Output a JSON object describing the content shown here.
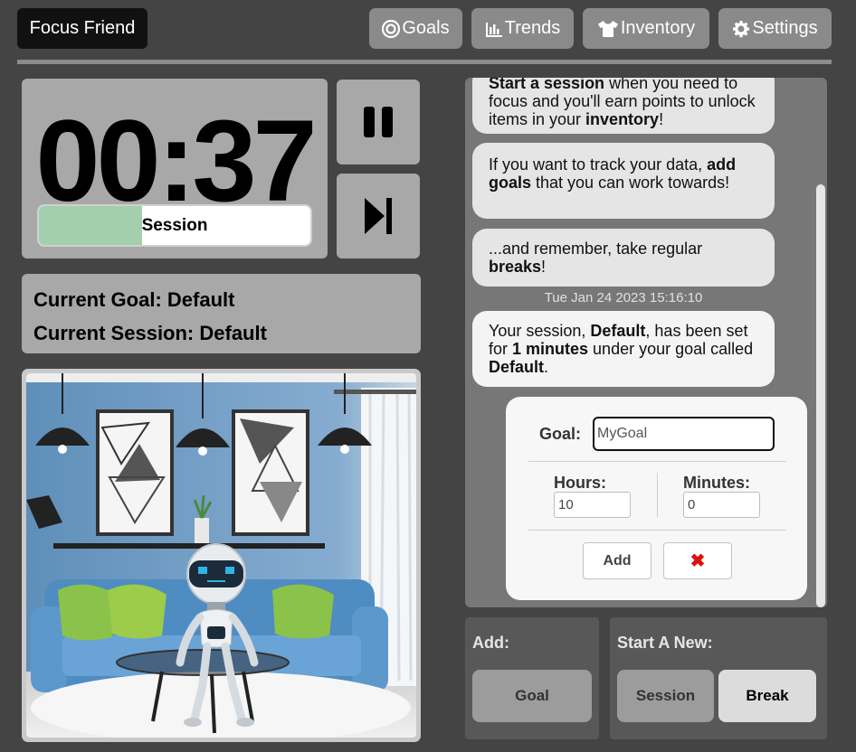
{
  "header": {
    "brand": "Focus Friend",
    "nav": [
      {
        "label": "Goals",
        "icon": "target-icon"
      },
      {
        "label": "Trends",
        "icon": "bar-chart-icon"
      },
      {
        "label": "Inventory",
        "icon": "tshirt-icon"
      },
      {
        "label": "Settings",
        "icon": "gear-icon"
      }
    ]
  },
  "timer": {
    "display": "00:37",
    "session_label": "Session",
    "progress": 0.38,
    "pause_icon": "pause-icon",
    "skip_icon": "skip-next-icon"
  },
  "info": {
    "goal_line": "Current Goal: Default",
    "session_line": "Current Session: Default"
  },
  "scene": {
    "description_icon": "robot-room-scene"
  },
  "chat": {
    "messages": [
      {
        "parts": [
          [
            "b",
            "Start a session"
          ],
          [
            "t",
            " when you need to focus and you'll earn points to unlock items in your "
          ],
          [
            "b",
            "inventory"
          ],
          [
            "t",
            "!"
          ]
        ]
      },
      {
        "parts": [
          [
            "t",
            "If you want to track your data, "
          ],
          [
            "b",
            "add goals"
          ],
          [
            "t",
            " that you can work towards!"
          ]
        ]
      },
      {
        "parts": [
          [
            "t",
            "...and remember, take regular "
          ],
          [
            "b",
            "breaks"
          ],
          [
            "t",
            "!"
          ]
        ]
      },
      {
        "parts": [
          [
            "t",
            "Your session, "
          ],
          [
            "b",
            "Default"
          ],
          [
            "t",
            ", has been set for "
          ],
          [
            "b",
            "1 minutes"
          ],
          [
            "t",
            " under your goal called "
          ],
          [
            "b",
            "Default"
          ],
          [
            "t",
            "."
          ]
        ]
      }
    ],
    "timestamp": "Tue Jan 24 2023 15:16:10"
  },
  "goal_form": {
    "goal_label": "Goal:",
    "goal_value": "MyGoal",
    "hours_label": "Hours:",
    "hours_value": "10",
    "minutes_label": "Minutes:",
    "minutes_value": "0",
    "add_label": "Add",
    "cancel_label": "✖"
  },
  "add_panel": {
    "title": "Add:",
    "goal_button": "Goal"
  },
  "start_panel": {
    "title": "Start A New:",
    "session_button": "Session",
    "break_button": "Break"
  },
  "colors": {
    "background": "#444444",
    "panel": "#a8a8a8",
    "progress_fill": "#a3cfac",
    "accent_red": "#e01010"
  }
}
